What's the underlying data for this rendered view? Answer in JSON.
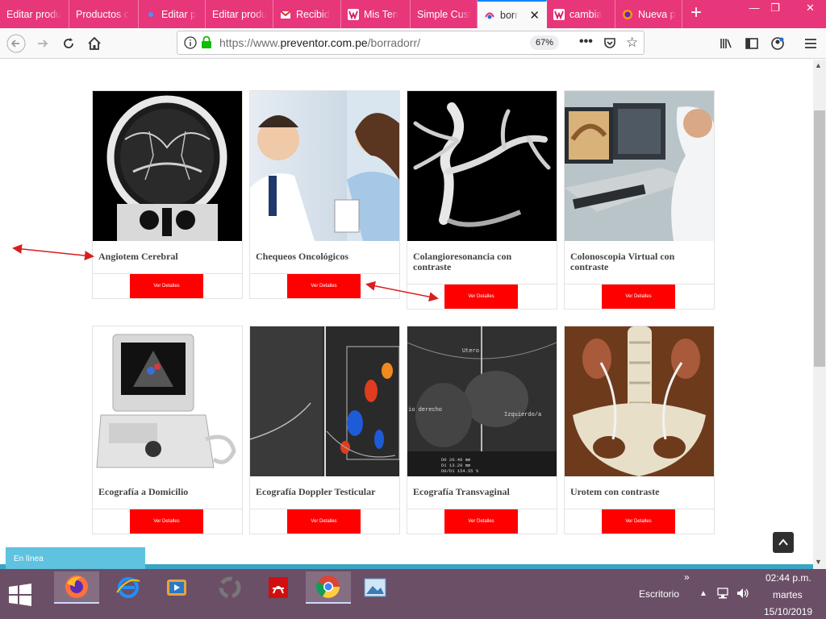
{
  "browser": {
    "tabs": [
      {
        "label": "Editar produ",
        "icon": "none"
      },
      {
        "label": "Productos c",
        "icon": "none"
      },
      {
        "label": "Editar p",
        "icon": "dot-icon"
      },
      {
        "label": "Editar produ",
        "icon": "none"
      },
      {
        "label": "Recibid",
        "icon": "gmail-icon"
      },
      {
        "label": "Mis Ten",
        "icon": "web-icon"
      },
      {
        "label": "Simple Cust",
        "icon": "none"
      },
      {
        "label": "borr",
        "icon": "site-icon",
        "active": true
      },
      {
        "label": "cambia",
        "icon": "web-icon"
      },
      {
        "label": "Nueva p",
        "icon": "firefox-icon"
      }
    ],
    "new_tab_label": "+",
    "url_prefix": "https://www.",
    "url_host": "preventor.com.pe",
    "url_path": "/borradorr/",
    "zoom": "67%",
    "accent_color": "#e8367a"
  },
  "page": {
    "button_color": "#ff0000",
    "cards": [
      {
        "title": "Angiotem Cerebral",
        "button": "Ver Detalles",
        "image": "brain-ct-scan"
      },
      {
        "title": "Chequeos Oncológicos",
        "button": "Ver Detalles",
        "image": "doctor-patient-photo"
      },
      {
        "title": "Colangioresonancia con contraste",
        "button": "Ver Detalles",
        "image": "mri-bile-duct"
      },
      {
        "title": "Colonoscopia Virtual con contraste",
        "button": "Ver Detalles",
        "image": "radiologist-workstation"
      },
      {
        "title": "Ecografía a Domicilio",
        "button": "Ver Detalles",
        "image": "portable-ultrasound"
      },
      {
        "title": "Ecografía Doppler Testicular",
        "button": "Ver Detalles",
        "image": "doppler-scan"
      },
      {
        "title": "Ecografía Transvaginal",
        "button": "Ver Detalles",
        "image": "ultrasound-scan"
      },
      {
        "title": "Urotem con contraste",
        "button": "Ver Detalles",
        "image": "ct-3d-render"
      }
    ],
    "ultrasound_labels": {
      "top": "Utero",
      "left": "io derecho",
      "right": "Izquierdo/a",
      "m1": "D0   20.40 mm",
      "m2": "D1   13.20 mm",
      "m3": "D0/D1  154.55 %"
    },
    "chat_label": "En línea"
  },
  "taskbar": {
    "desktop_label": "Escritorio",
    "time": "02:44 p.m.",
    "day": "martes",
    "date": "15/10/2019",
    "apps": [
      "firefox-icon",
      "internet-explorer-icon",
      "media-player-icon",
      "app-swirl-icon",
      "pdf-reader-icon",
      "chrome-icon",
      "image-viewer-icon"
    ]
  }
}
